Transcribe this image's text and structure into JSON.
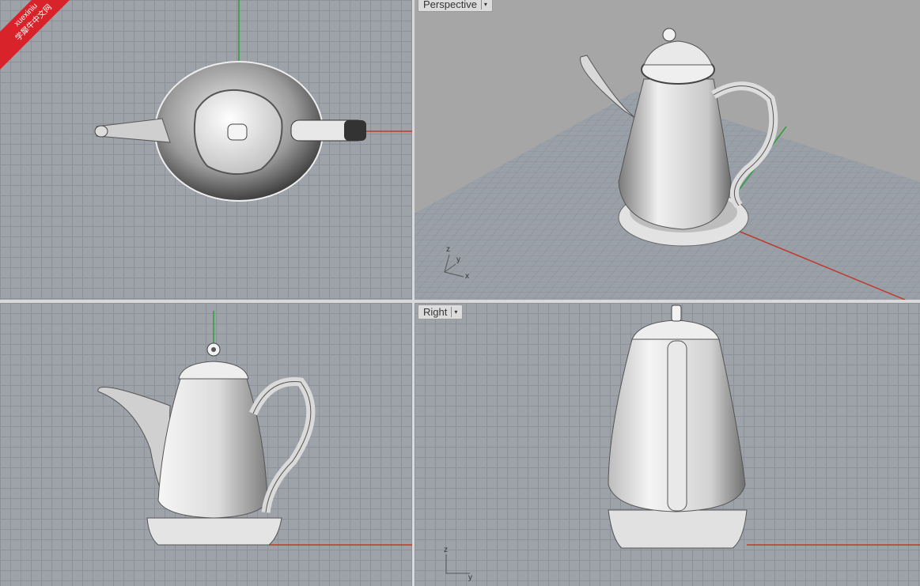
{
  "viewports": {
    "perspective": {
      "label": "Perspective"
    },
    "right": {
      "label": "Right"
    }
  },
  "watermark": {
    "line1": "xuexiniu",
    "line2": "学犀牛中文网"
  },
  "axes": {
    "persp": {
      "z": "z",
      "y": "y",
      "x": "x"
    },
    "right": {
      "z": "z",
      "y": "y"
    }
  },
  "icons": {
    "dropdown": "chevron-down-icon"
  },
  "colors": {
    "grid_bg": "#9ea3a9",
    "grid_line": "#8d9198",
    "x_axis": "#c0392b",
    "y_axis": "#2e9e3a"
  }
}
